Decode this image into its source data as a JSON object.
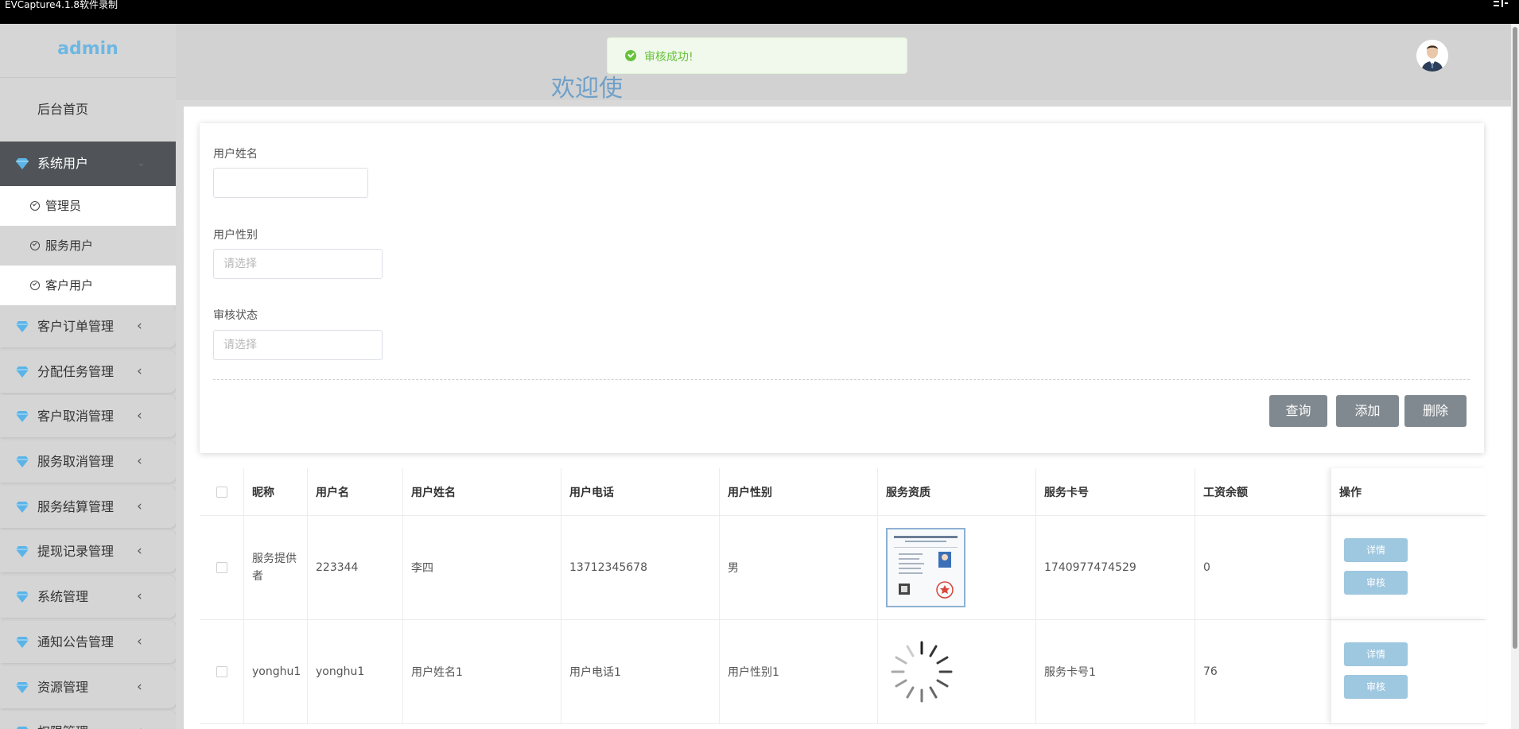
{
  "titlebar": {
    "title": "EVCapture4.1.8软件录制"
  },
  "sidebar": {
    "brand": "admin",
    "home": "后台首页",
    "active_menu": "系统用户",
    "sub_items": [
      "管理员",
      "服务用户",
      "客户用户"
    ],
    "groups": [
      "客户订单管理",
      "分配任务管理",
      "客户取消管理",
      "服务取消管理",
      "服务结算管理",
      "提现记录管理",
      "系统管理",
      "通知公告管理",
      "资源管理",
      "权限管理"
    ]
  },
  "header": {
    "welcome": "欢迎使",
    "toast": "审核成功!"
  },
  "form": {
    "name_label": "用户姓名",
    "name_value": "",
    "gender_label": "用户性别",
    "gender_placeholder": "请选择",
    "status_label": "审核状态",
    "status_placeholder": "请选择",
    "btn_query": "查询",
    "btn_add": "添加",
    "btn_delete": "删除"
  },
  "table": {
    "headers": [
      "昵称",
      "用户名",
      "用户姓名",
      "用户电话",
      "用户性别",
      "服务资质",
      "服务卡号",
      "工资余额",
      "操作"
    ],
    "rows": [
      {
        "nickname": "服务提供者",
        "username": "223344",
        "realname": "李四",
        "phone": "13712345678",
        "gender": "男",
        "card": "1740977474529",
        "balance": "0"
      },
      {
        "nickname": "yonghu1",
        "username": "yonghu1",
        "realname": "用户姓名1",
        "phone": "用户电话1",
        "gender": "用户性别1",
        "card": "服务卡号1",
        "balance": "76"
      }
    ],
    "btn_detail": "详情",
    "btn_review": "审核"
  },
  "colors": {
    "accent": "#6fb7e3",
    "active_menu_bg": "#505458",
    "button_grey": "#80898f",
    "op_button": "#9ec7e0",
    "toast_green": "#67c23a"
  }
}
